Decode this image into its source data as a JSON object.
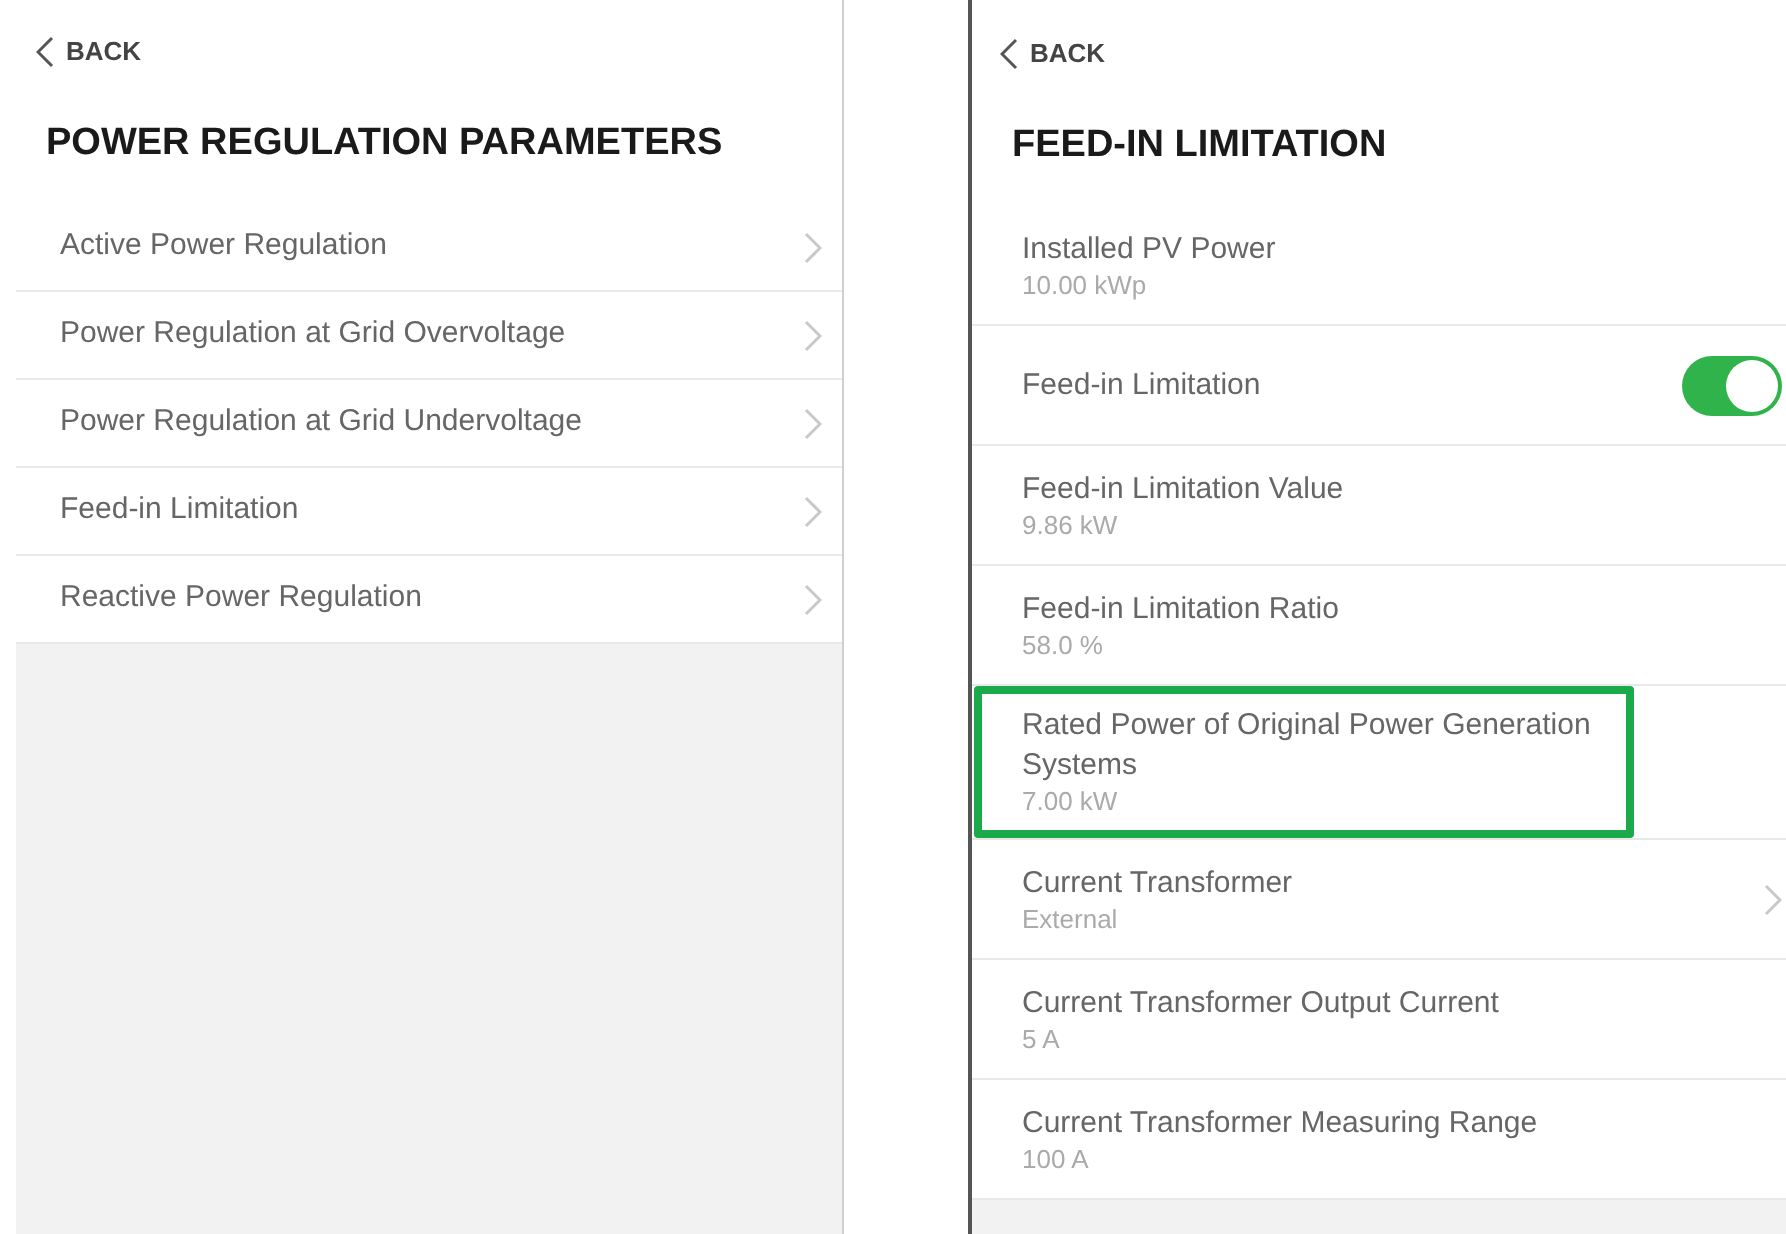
{
  "left_panel": {
    "back": "BACK",
    "title": "POWER REGULATION PARAMETERS",
    "items": [
      {
        "label": "Active Power Regulation"
      },
      {
        "label": "Power Regulation at Grid Overvoltage"
      },
      {
        "label": "Power Regulation at Grid Undervoltage"
      },
      {
        "label": "Feed-in Limitation"
      },
      {
        "label": "Reactive Power Regulation"
      }
    ]
  },
  "right_panel": {
    "back": "BACK",
    "title": "FEED-IN LIMITATION",
    "rows": [
      {
        "kind": "value",
        "label": "Installed PV Power",
        "value": "10.00 kWp",
        "highlighted": false
      },
      {
        "kind": "toggle",
        "label": "Feed-in Limitation",
        "on": true,
        "highlighted": false
      },
      {
        "kind": "value",
        "label": "Feed-in Limitation Value",
        "value": "9.86 kW",
        "highlighted": false
      },
      {
        "kind": "value",
        "label": "Feed-in Limitation Ratio",
        "value": "58.0 %",
        "highlighted": false
      },
      {
        "kind": "value",
        "label": "Rated Power of Original Power Generation Systems",
        "value": "7.00 kW",
        "highlighted": true
      },
      {
        "kind": "link",
        "label": "Current Transformer",
        "value": "External",
        "highlighted": false
      },
      {
        "kind": "value",
        "label": "Current Transformer Output Current",
        "value": "5 A",
        "highlighted": false
      },
      {
        "kind": "value",
        "label": "Current Transformer Measuring Range",
        "value": "100 A",
        "highlighted": false
      }
    ]
  }
}
